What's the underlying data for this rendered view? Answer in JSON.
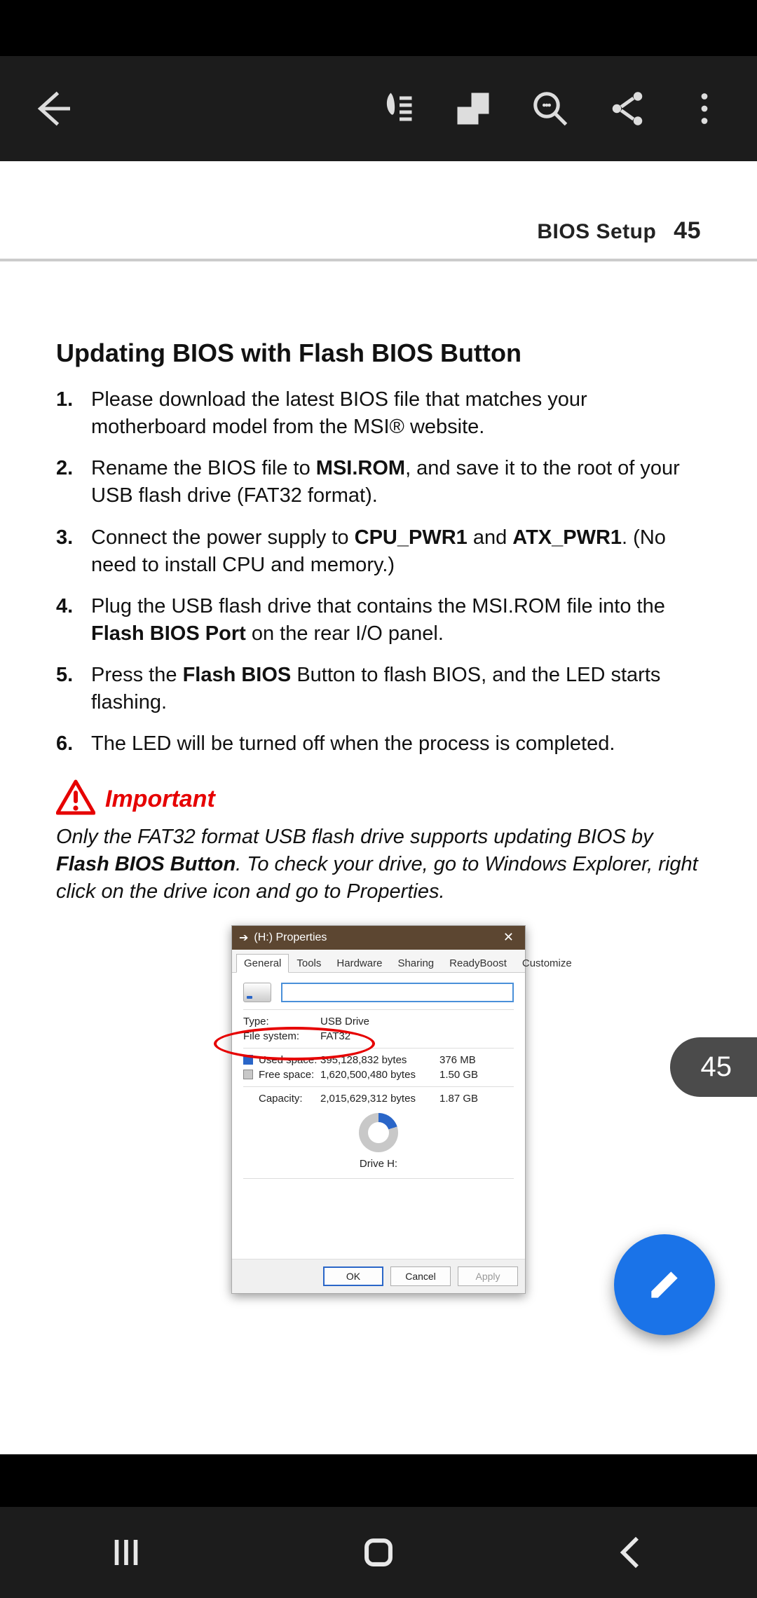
{
  "running_header": {
    "section": "BIOS Setup",
    "page": "45"
  },
  "title": "Updating BIOS with Flash BIOS Button",
  "steps": {
    "s1a": "Please download the latest BIOS file that matches your motherboard model from the MSI",
    "s1b": " website.",
    "s2a": "Rename the BIOS file to ",
    "s2b": "MSI.ROM",
    "s2c": ", and save it to the root of your USB flash drive (FAT32 format).",
    "s3a": "Connect the power supply to ",
    "s3b": "CPU_PWR1",
    "s3c": " and ",
    "s3d": "ATX_PWR1",
    "s3e": ". (No need to install CPU and memory.)",
    "s4a": "Plug the USB flash drive that contains the MSI.ROM file into the ",
    "s4b": "Flash BIOS Port",
    "s4c": " on the rear I/O panel.",
    "s5a": "Press the ",
    "s5b": "Flash BIOS",
    "s5c": " Button to flash BIOS, and the LED starts flashing.",
    "s6": "The LED will be turned off when the process is completed."
  },
  "important": {
    "label": "Important",
    "t1": "Only the FAT32 format USB flash drive supports updating BIOS by ",
    "t1b": "Flash BIOS Button",
    "t2": ". To check your drive, go to Windows Explorer, right click on the drive icon and go to Properties."
  },
  "dialog": {
    "title": "(H:) Properties",
    "tabs": [
      "General",
      "Tools",
      "Hardware",
      "Sharing",
      "ReadyBoost",
      "Customize"
    ],
    "type_k": "Type:",
    "type_v": "USB Drive",
    "fs_k": "File system:",
    "fs_v": "FAT32",
    "used_k": "Used space:",
    "used_bytes": "395,128,832 bytes",
    "used_h": "376 MB",
    "free_k": "Free space:",
    "free_bytes": "1,620,500,480 bytes",
    "free_h": "1.50 GB",
    "cap_k": "Capacity:",
    "cap_bytes": "2,015,629,312 bytes",
    "cap_h": "1.87 GB",
    "drive_label": "Drive H:",
    "ok": "OK",
    "cancel": "Cancel",
    "apply": "Apply"
  },
  "bubble_page": "45"
}
